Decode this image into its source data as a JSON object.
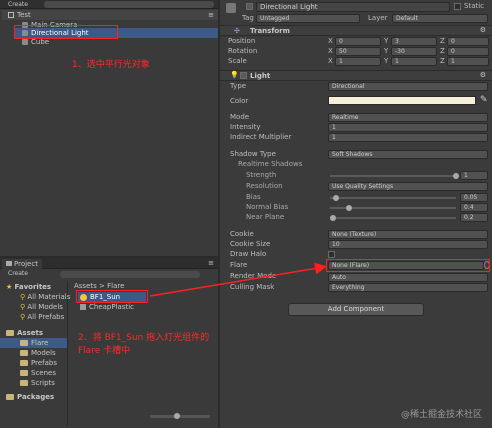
{
  "hierarchy": {
    "create_label": "Create",
    "scene_name": "Test",
    "items": [
      "Main Camera",
      "Directional Light",
      "Cube"
    ]
  },
  "annotations": {
    "step1": "1、选中平行光对象",
    "step2": "2、将 BF1_Sun 拖入灯光组件的 Flare 卡槽中"
  },
  "project": {
    "tab_label": "Project",
    "create_label": "Create",
    "favorites_label": "Favorites",
    "favorites": [
      "All Materials",
      "All Models",
      "All Prefabs"
    ],
    "assets_label": "Assets",
    "folders": [
      "Flare",
      "Models",
      "Prefabs",
      "Scenes",
      "Scripts"
    ],
    "packages_label": "Packages",
    "breadcrumb": [
      "Assets",
      "Flare"
    ],
    "breadcrumb_sep": ">",
    "files": [
      "BF1_Sun",
      "CheapPlastic"
    ]
  },
  "inspector": {
    "object_name": "Directional Light",
    "static_label": "Static",
    "tag_label": "Tag",
    "tag_value": "Untagged",
    "layer_label": "Layer",
    "layer_value": "Default",
    "transform": {
      "title": "Transform",
      "rows": [
        {
          "label": "Position",
          "x": "0",
          "y": "3",
          "z": "0"
        },
        {
          "label": "Rotation",
          "x": "50",
          "y": "-30",
          "z": "0"
        },
        {
          "label": "Scale",
          "x": "1",
          "y": "1",
          "z": "1"
        }
      ],
      "axis_x": "X",
      "axis_y": "Y",
      "axis_z": "Z"
    },
    "light": {
      "title": "Light",
      "type_label": "Type",
      "type_value": "Directional",
      "color_label": "Color",
      "color_value": "#f6f0d8",
      "mode_label": "Mode",
      "mode_value": "Realtime",
      "intensity_label": "Intensity",
      "intensity_value": "1",
      "indirect_label": "Indirect Multiplier",
      "indirect_value": "1",
      "shadow_type_label": "Shadow Type",
      "shadow_type_value": "Soft Shadows",
      "realtime_shadows_label": "Realtime Shadows",
      "strength_label": "Strength",
      "strength_value": "1",
      "strength_level": 1.0,
      "resolution_label": "Resolution",
      "resolution_value": "Use Quality Settings",
      "bias_label": "Bias",
      "bias_value": "0.05",
      "bias_level": 0.025,
      "normal_bias_label": "Normal Bias",
      "normal_bias_value": "0.4",
      "normal_bias_level": 0.13,
      "near_plane_label": "Near Plane",
      "near_plane_value": "0.2",
      "near_plane_level": 0.0,
      "cookie_label": "Cookie",
      "cookie_value": "None (Texture)",
      "cookie_size_label": "Cookie Size",
      "cookie_size_value": "10",
      "draw_halo_label": "Draw Halo",
      "flare_label": "Flare",
      "flare_value": "None (Flare)",
      "render_mode_label": "Render Mode",
      "render_mode_value": "Auto",
      "culling_label": "Culling Mask",
      "culling_value": "Everything"
    },
    "add_component_label": "Add Component"
  },
  "watermark": "@稀土掘金技术社区",
  "accent_red": "#ff2020",
  "selection_blue": "#3d5a86"
}
